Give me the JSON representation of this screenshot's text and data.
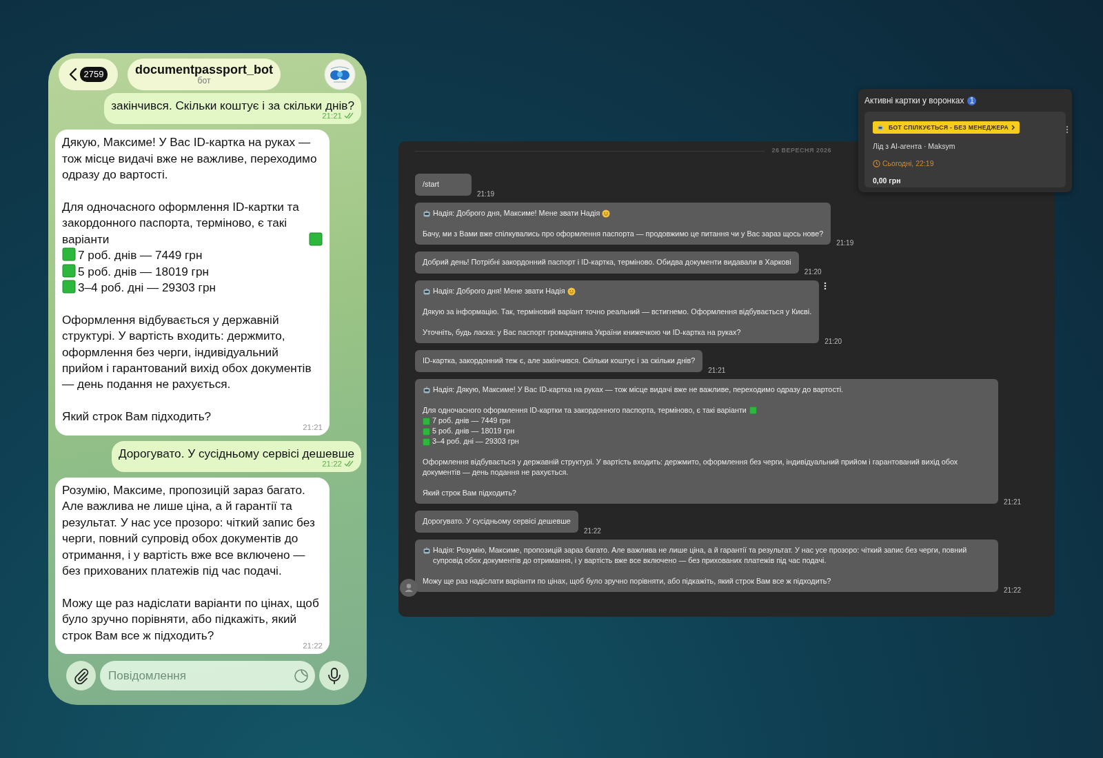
{
  "phone": {
    "header": {
      "back_count": "2759",
      "title": "documentpassport_bot",
      "subtitle": "бот"
    },
    "messages": [
      {
        "kind": "sent",
        "paragraphs": [
          [
            {
              "kind": "text",
              "text": "закінчився. Скільки коштує і за скільки днів?"
            }
          ]
        ],
        "time": "21:21"
      },
      {
        "kind": "received",
        "paragraphs": [
          [
            {
              "kind": "text",
              "text": "Дякую, Максиме! У Вас ID-картка на руках — тож місце видачі вже не важливе, переходимо одразу до вартості."
            }
          ],
          [
            {
              "kind": "tail",
              "text": "Для одночасного оформлення ID-картки та закордонного паспорта, терміново, є такі варіанти"
            },
            {
              "kind": "bullet",
              "text": "7 роб. днів — 7449 грн"
            },
            {
              "kind": "bullet",
              "text": "5 роб. днів — 18019 грн"
            },
            {
              "kind": "bullet",
              "text": "3–4 роб. дні — 29303 грн"
            }
          ],
          [
            {
              "kind": "text",
              "text": "Оформлення відбувається у державній структурі. У вартість входить: держмито, оформлення без черги, індивідуальний прийом і гарантований вихід обох документів — день подання не рахується."
            }
          ],
          [
            {
              "kind": "text",
              "text": "Який строк Вам підходить?"
            }
          ]
        ],
        "time": "21:21"
      },
      {
        "kind": "sent",
        "paragraphs": [
          [
            {
              "kind": "text",
              "text": "Дорогувато. У сусідньому сервісі дешевше"
            }
          ]
        ],
        "time": "21:22"
      },
      {
        "kind": "received",
        "paragraphs": [
          [
            {
              "kind": "text",
              "text": "Розумію, Максиме, пропозицій зараз багато. Але важлива не лише ціна, а й гарантії та результат. У нас усе прозоро: чіткий запис без черги, повний супровід обох документів до отримання, і у вартість вже все включено — без прихованих платежів під час подачі."
            }
          ],
          [
            {
              "kind": "text",
              "text": "Можу ще раз надіслати варіанти по цінах, щоб було зручно порівняти, або підкажіть, який строк Вам все ж підходить?"
            }
          ]
        ],
        "time": "21:22"
      }
    ],
    "composer": {
      "placeholder": "Повідомлення"
    }
  },
  "crm_chat": {
    "date": "26 ВЕРЕСНЯ 2026",
    "messages": [
      {
        "paragraphs": [
          [
            {
              "kind": "text",
              "text": "/start"
            }
          ]
        ],
        "time": "21:19",
        "has_menu": false
      },
      {
        "paragraphs": [
          [
            {
              "kind": "bot-smile",
              "text": "Надія: Доброго дня, Максиме! Мене звати Надія"
            }
          ],
          [
            {
              "kind": "text",
              "text": "Бачу, ми з Вами вже спілкувались про оформлення паспорта — продовжимо це питання чи у Вас зараз щось нове?"
            }
          ]
        ],
        "time": "21:19",
        "has_menu": false
      },
      {
        "paragraphs": [
          [
            {
              "kind": "text",
              "text": "Добрий день! Потрібні закордонний паспорт і ID-картка, терміново. Обидва документи видавали в Харкові"
            }
          ]
        ],
        "time": "21:20",
        "has_menu": false
      },
      {
        "paragraphs": [
          [
            {
              "kind": "bot-smile",
              "text": "Надія: Доброго дня! Мене звати Надія"
            }
          ],
          [
            {
              "kind": "text",
              "text": "Дякую за інформацію. Так, терміновий варіант точно реальний — встигнемо. Оформлення відбувається у Києві."
            }
          ],
          [
            {
              "kind": "text",
              "text": "Уточніть, будь ласка: у Вас паспорт громадянина України книжечкою чи ID-картка на руках?"
            }
          ]
        ],
        "time": "21:20",
        "has_menu": true
      },
      {
        "paragraphs": [
          [
            {
              "kind": "text",
              "text": "ID-картка, закордонний теж є, але закінчився. Скільки коштує і за скільки днів?"
            }
          ]
        ],
        "time": "21:21",
        "has_menu": false
      },
      {
        "paragraphs": [
          [
            {
              "kind": "bot",
              "text": "Надія: Дякую, Максиме! У Вас ID-картка на руках — тож місце видачі вже не важливе, переходимо одразу до вартості."
            }
          ],
          [
            {
              "kind": "tail",
              "text": "Для одночасного оформлення ID-картки та закордонного паспорта, терміново, є такі варіанти"
            },
            {
              "kind": "bullet",
              "text": "7 роб. днів — 7449 грн"
            },
            {
              "kind": "bullet",
              "text": "5 роб. днів — 18019 грн"
            },
            {
              "kind": "bullet",
              "text": "3–4 роб. дні — 29303 грн"
            }
          ],
          [
            {
              "kind": "text",
              "text": "Оформлення відбувається у державній структурі. У вартість входить: держмито, оформлення без черги, індивідуальний прийом і гарантований вихід обох документів — день подання не рахується."
            }
          ],
          [
            {
              "kind": "text",
              "text": "Який строк Вам підходить?"
            }
          ]
        ],
        "time": "21:21",
        "has_menu": false
      },
      {
        "paragraphs": [
          [
            {
              "kind": "text",
              "text": "Дорогувато. У сусідньому сервісі дешевше"
            }
          ]
        ],
        "time": "21:22",
        "has_menu": false
      },
      {
        "paragraphs": [
          [
            {
              "kind": "bot",
              "text": "Надія: Розумію, Максиме, пропозицій зараз багато. Але важлива не лише ціна, а й гарантії та результат. У нас усе прозоро: чіткий запис без черги, повний супровід обох документів до отримання, і у вартість вже все включено — без прихованих платежів під час подачі."
            }
          ],
          [
            {
              "kind": "text",
              "text": "Можу ще раз надіслати варіанти по цінах, щоб було зручно порівняти, або підкажіть, який строк Вам все ж підходить?"
            }
          ]
        ],
        "time": "21:22",
        "has_menu": false
      }
    ]
  },
  "funnel_card": {
    "title": "Активні картки у воронках",
    "count": "1",
    "tag": "БОТ СПІЛКУЄТЬСЯ - БЕЗ МЕНЕДЖЕРА",
    "lead": "Лід з AI-агента · Maksym",
    "due": "Сьогодні, 22:19",
    "amount": "0,00 грн"
  }
}
